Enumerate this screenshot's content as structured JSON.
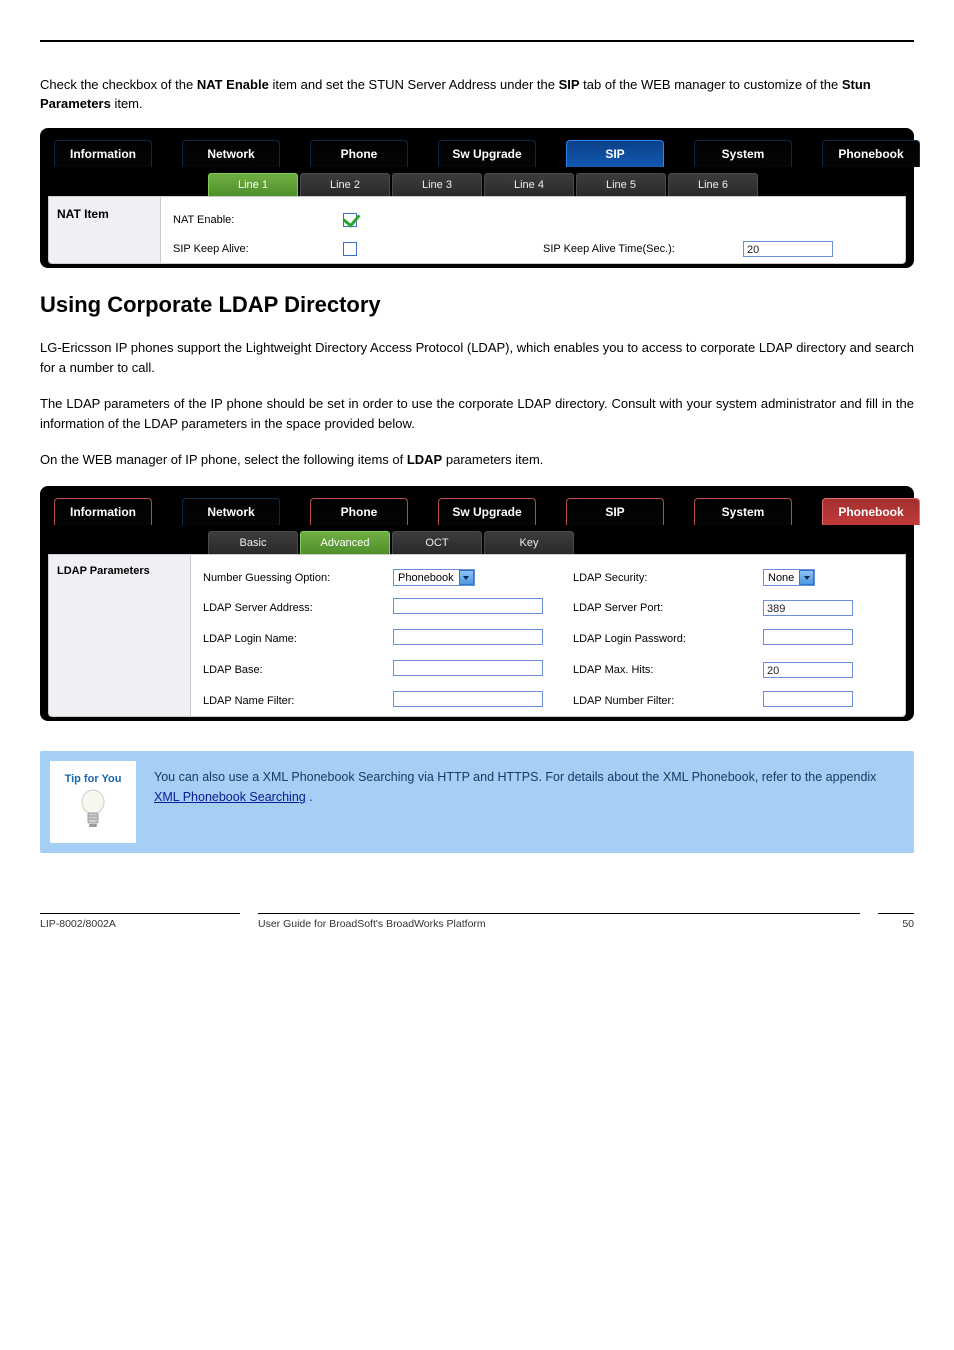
{
  "intro": {
    "prefix": "Check the checkbox of the ",
    "bold1": "NAT Enable",
    "mid": " item and set the STUN Server Address under the ",
    "bold2": "SIP",
    "mid2": " tab of the WEB manager to customize of the ",
    "bold3": "Stun Parameters",
    "suffix": " item."
  },
  "panel1": {
    "tabs": [
      "Information",
      "Network",
      "Phone",
      "Sw Upgrade",
      "SIP",
      "System",
      "Phonebook"
    ],
    "activeTab": 4,
    "subtabs": [
      "Line 1",
      "Line 2",
      "Line 3",
      "Line 4",
      "Line 5",
      "Line 6"
    ],
    "sideLabel": "NAT Item",
    "nat_enable_label": "NAT Enable:",
    "sip_keep_alive_label": "SIP Keep Alive:",
    "keep_alive_time_label": "SIP Keep Alive Time(Sec.):",
    "keep_alive_time_value": "20"
  },
  "section_heading": "Using Corporate LDAP Directory",
  "paragraphs": {
    "p1": "LG-Ericsson IP phones support the Lightweight Directory Access Protocol (LDAP), which enables you to access to corporate LDAP directory and search for a number to call.",
    "p2": "The LDAP parameters of the IP phone should be set in order to use the corporate LDAP directory. Consult with your system administrator and fill in the information of the LDAP parameters in the space provided below.",
    "p3_before_bold": "On the WEB manager of IP phone, select the following items of ",
    "p3_bold": "LDAP",
    "p3_after_bold": " parameters item."
  },
  "panel2": {
    "tabs": [
      "Information",
      "Network",
      "Phone",
      "Sw Upgrade",
      "SIP",
      "System",
      "Phonebook"
    ],
    "activeTab": 6,
    "subtabs": [
      "Basic",
      "Advanced",
      "OCT",
      "Key"
    ],
    "sideLabel": "LDAP Parameters",
    "labels": {
      "number_guessing": "Number Guessing Option:",
      "ldap_security": "LDAP Security:",
      "server_addr": "LDAP Server Address:",
      "server_port": "LDAP Server Port:",
      "login_name": "LDAP Login Name:",
      "login_pw": "LDAP Login Password:",
      "base": "LDAP Base:",
      "max_hits": "LDAP Max. Hits:",
      "name_filter": "LDAP Name Filter:",
      "number_filter": "LDAP Number Filter:"
    },
    "values": {
      "number_guessing": "Phonebook",
      "ldap_security": "None",
      "server_port": "389",
      "max_hits": "20"
    }
  },
  "callout": {
    "tip_label": "Tip for You",
    "text_before": "You can also use a XML Phonebook Searching via HTTP and HTTPS. For details about the XML Phonebook, refer to the appendix ",
    "link_text": "XML Phonebook Searching",
    "text_after": "."
  },
  "footer": {
    "col1": "LIP-8002/8002A",
    "col2": "User Guide for BroadSoft's BroadWorks Platform",
    "col3": "50"
  }
}
